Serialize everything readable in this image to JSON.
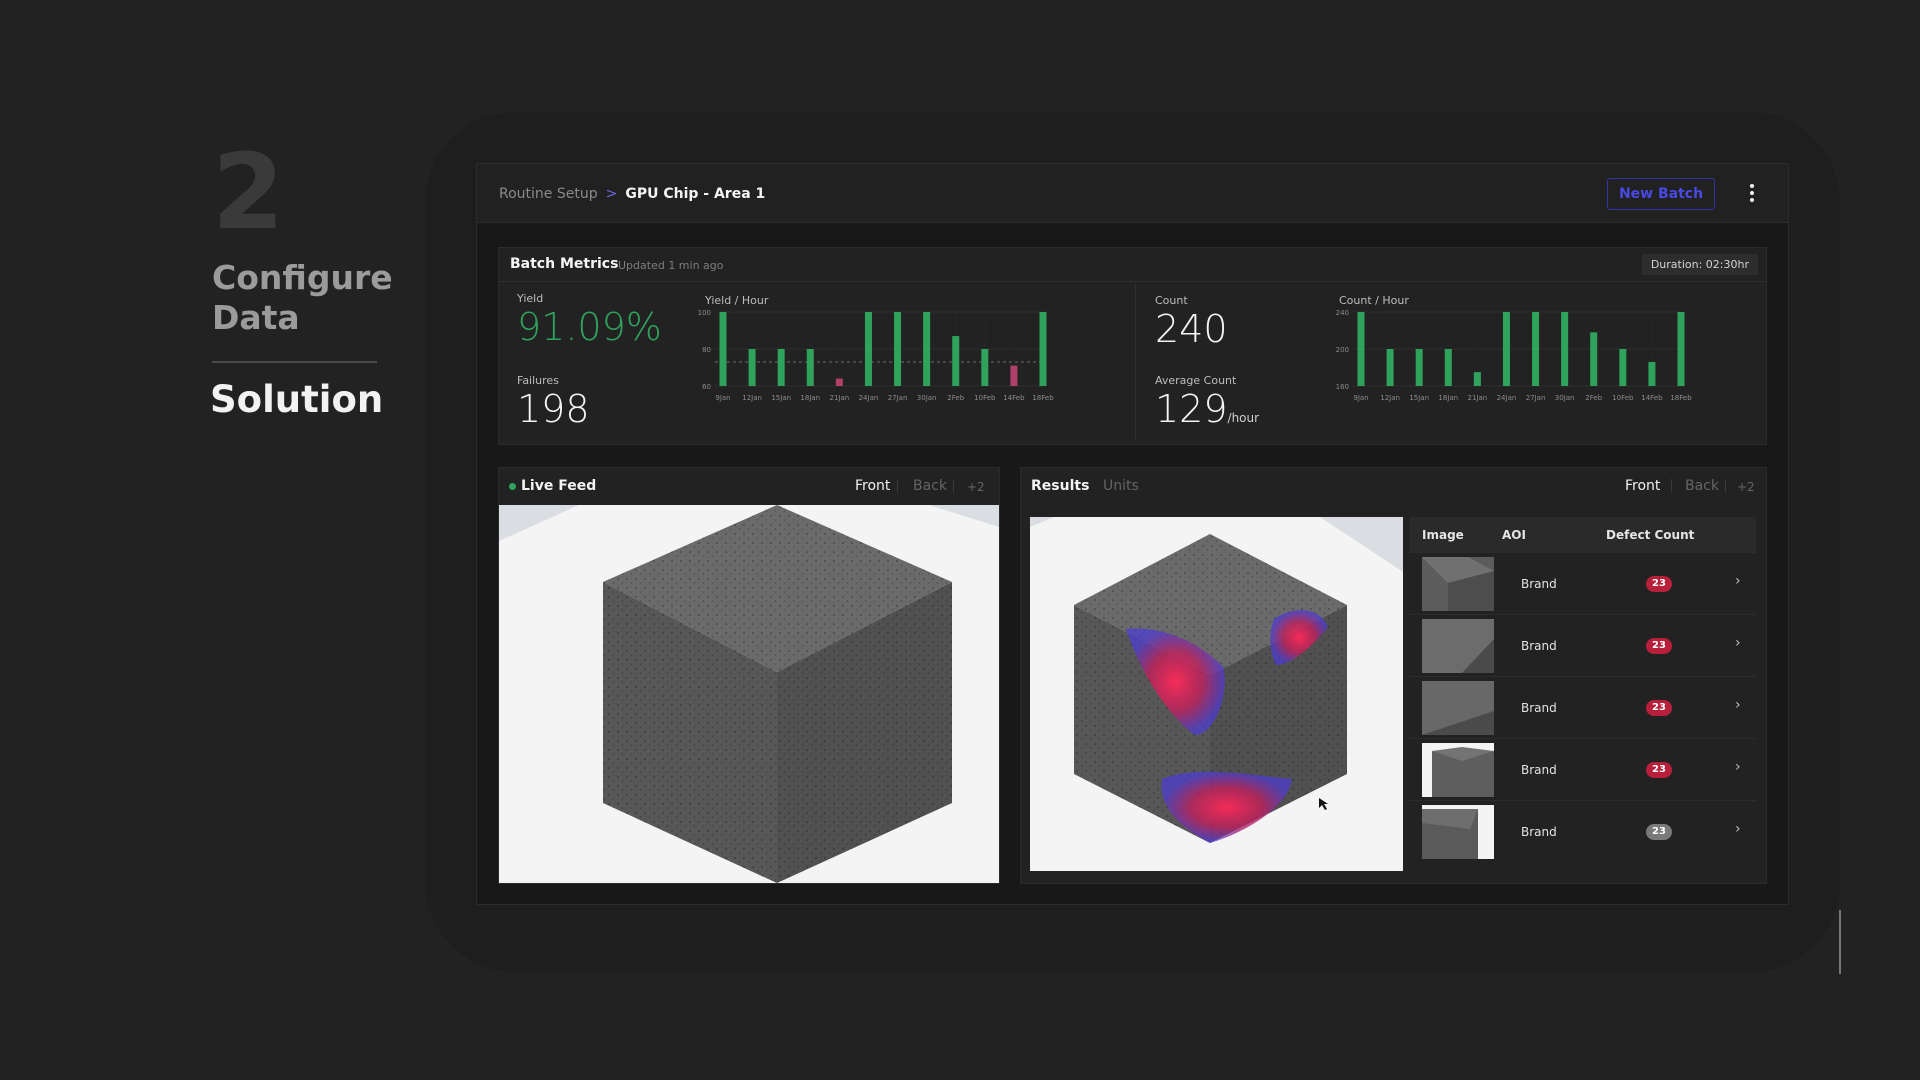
{
  "slide": {
    "step_number": "2",
    "title_line1": "Configure",
    "title_line2": "Data",
    "subtitle": "Solution"
  },
  "topbar": {
    "breadcrumb_parent": "Routine Setup",
    "breadcrumb_sep": ">",
    "breadcrumb_current": "GPU Chip - Area 1",
    "new_batch_label": "New Batch"
  },
  "metrics": {
    "title": "Batch Metrics",
    "updated": "Updated 1 min ago",
    "duration": "Duration: 02:30hr",
    "yield_label": "Yield",
    "yield_value": "91.09%",
    "failures_label": "Failures",
    "failures_value": "198",
    "count_label": "Count",
    "count_value": "240",
    "avg_count_label": "Average Count",
    "avg_count_value": "129",
    "avg_count_unit": "/hour"
  },
  "chart_data": [
    {
      "type": "bar",
      "title": "Yield / Hour",
      "categories": [
        "9Jan",
        "12Jan",
        "15Jan",
        "18Jan",
        "21Jan",
        "24Jan",
        "27Jan",
        "30Jan",
        "2Feb",
        "10Feb",
        "14Feb",
        "18Feb"
      ],
      "values": [
        100,
        80,
        80,
        80,
        64,
        100,
        100,
        100,
        87,
        80,
        71,
        100
      ],
      "highlight": [
        false,
        false,
        false,
        false,
        true,
        false,
        false,
        false,
        false,
        false,
        true,
        false
      ],
      "yticks": [
        100,
        80,
        60
      ],
      "ylim": [
        60,
        100
      ],
      "reference_line": 73,
      "colors": {
        "normal": "#2fa35c",
        "highlight": "#b0406a"
      }
    },
    {
      "type": "bar",
      "title": "Count / Hour",
      "categories": [
        "9Jan",
        "12Jan",
        "15Jan",
        "18Jan",
        "21Jan",
        "24Jan",
        "27Jan",
        "30Jan",
        "2Feb",
        "10Feb",
        "14Feb",
        "18Feb"
      ],
      "values": [
        240,
        200,
        200,
        200,
        175,
        240,
        240,
        240,
        218,
        200,
        186,
        240
      ],
      "highlight": [
        false,
        false,
        false,
        false,
        false,
        false,
        false,
        false,
        false,
        false,
        false,
        false
      ],
      "yticks": [
        240,
        200,
        160
      ],
      "ylim": [
        160,
        240
      ],
      "colors": {
        "normal": "#2fa35c",
        "highlight": "#b0406a"
      }
    }
  ],
  "live_feed": {
    "title": "Live Feed",
    "tabs": [
      "Front",
      "Back",
      "+2"
    ]
  },
  "results": {
    "tab_results": "Results",
    "tab_units": "Units",
    "tabs": [
      "Front",
      "Back",
      "+2"
    ],
    "columns": [
      "Image",
      "AOI",
      "Defect Count"
    ],
    "rows": [
      {
        "aoi": "Brand",
        "count": "23"
      },
      {
        "aoi": "Brand",
        "count": "23"
      },
      {
        "aoi": "Brand",
        "count": "23"
      },
      {
        "aoi": "Brand",
        "count": "23"
      },
      {
        "aoi": "Brand",
        "count": "23"
      }
    ],
    "badge_colors": [
      "#b81f3a",
      "#b81f3a",
      "#b81f3a",
      "#b81f3a",
      "#7a7a7a"
    ]
  },
  "colors": {
    "accent": "#4949e6",
    "success": "#2fa35c",
    "defect": "#b81f3a"
  }
}
